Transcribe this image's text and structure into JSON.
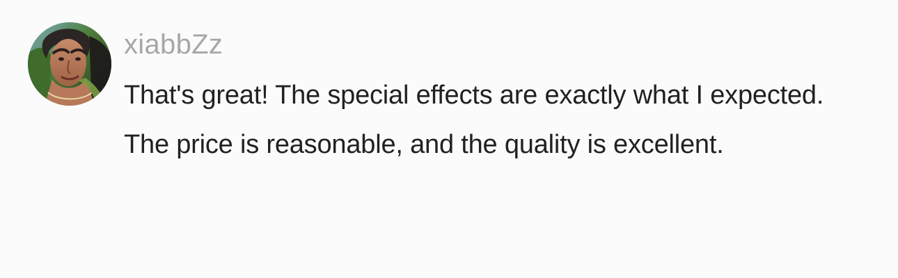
{
  "review": {
    "avatar_icon": "user-avatar-photo",
    "username": "xiabbZz",
    "comment": "That's great! The special effects are exactly what I expected. The price is reasonable, and the quality is excellent."
  },
  "colors": {
    "background": "#fbfbfb",
    "username": "#a7a7a7",
    "comment_text": "#212121"
  }
}
